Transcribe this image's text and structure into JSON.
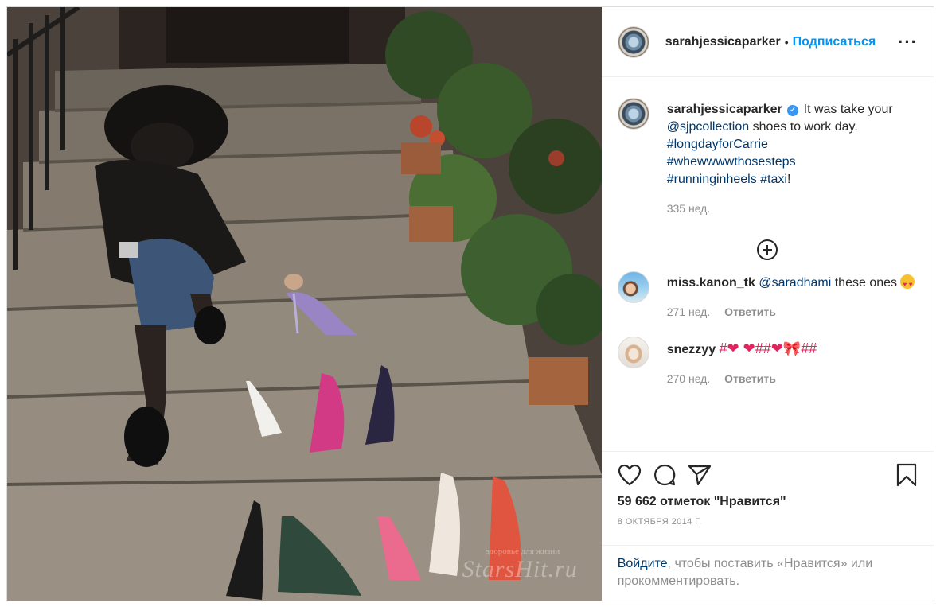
{
  "header": {
    "username": "sarahjessicaparker",
    "separator": "•",
    "follow_label": "Подписаться",
    "more_label": "···"
  },
  "caption": {
    "username": "sarahjessicaparker",
    "text_1": "It was take your",
    "mention": "@sjpcollection",
    "text_2": "shoes to work day.",
    "tag_1": "#longdayforCarrie",
    "tag_2": "#whewwwwthosesteps",
    "tag_3": "#runninginheels",
    "tag_4": "#taxi",
    "end": "!",
    "time": "335 нед."
  },
  "comments": [
    {
      "username": "miss.kanon_tk",
      "mention": "@saradhami",
      "text": "these ones",
      "time": "271 нед.",
      "reply_label": "Ответить"
    },
    {
      "username": "snezzyy",
      "text": "#❤ ❤##❤🎀##",
      "time": "270 нед.",
      "reply_label": "Ответить"
    }
  ],
  "stats": {
    "likes": "59 662 отметок \"Нравится\"",
    "date": "8 ОКТЯБРЯ 2014 Г."
  },
  "login_prompt": {
    "link": "Войдите",
    "text": ", чтобы поставить «Нравится» или прокомментировать."
  },
  "colors": {
    "accent": "#0095f6",
    "link": "#00376b",
    "muted": "#8e8e8e",
    "verified": "#3897f0"
  }
}
